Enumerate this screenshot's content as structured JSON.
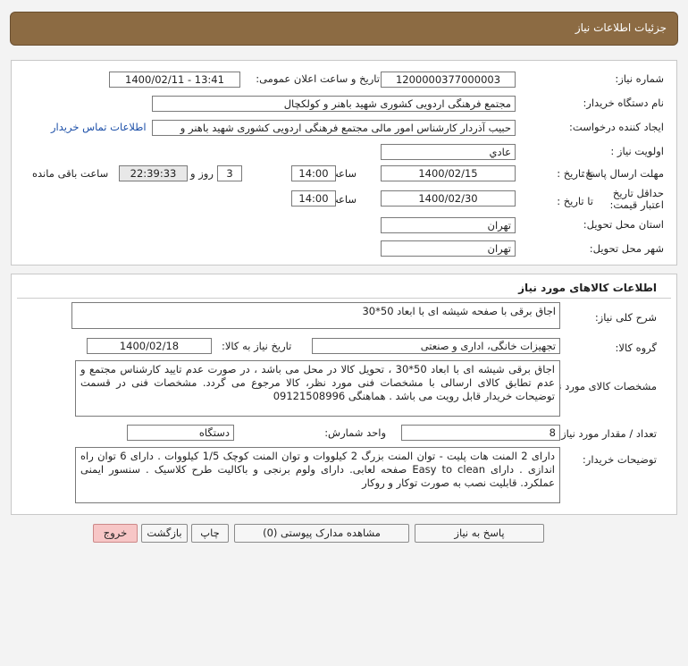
{
  "header": {
    "title": "جزئیات اطلاعات نیاز"
  },
  "details": {
    "need_number_label": "شماره نیاز:",
    "need_number": "1200000377000003",
    "announce_label": "تاریخ و ساعت اعلان عمومی:",
    "announce_value": "1400/02/11 - 13:41",
    "buyer_org_label": "نام دستگاه خریدار:",
    "buyer_org": "مجتمع فرهنگی اردویی کشوری شهید باهنر و کولکچال",
    "requester_label": "ایجاد کننده درخواست:",
    "requester": "حبیب آذردار کارشناس امور مالی  مجتمع فرهنگی اردویی کشوری شهید باهنر و",
    "contact_link": "اطلاعات تماس خریدار",
    "priority_label": "اولویت نیاز :",
    "priority": "عادي",
    "reply_deadline_label": "مهلت ارسال پاسخ:",
    "to_date_label": "تا تاریخ :",
    "reply_date": "1400/02/15",
    "time_label": "ساعت",
    "reply_time": "14:00",
    "days_value": "3",
    "days_label": "روز و",
    "remaining_time": "22:39:33",
    "remaining_label": "ساعت باقی مانده",
    "validity_label": "حداقل تاریخ اعتبار قیمت:",
    "validity_date": "1400/02/30",
    "validity_time": "14:00",
    "province_label": "استان محل تحویل:",
    "province": "تهران",
    "city_label": "شهر محل تحویل:",
    "city": "تهران"
  },
  "goods": {
    "section_title": "اطلاعات کالاهای مورد نیاز",
    "summary_label": "شرح کلی نیاز:",
    "summary": "اجاق برقی با صفحه شیشه ای با ابعاد 50*30",
    "group_label": "گروه کالا:",
    "group": "تجهیزات خانگی، اداری و صنعتی",
    "need_date_label": "تاریخ نیاز به کالا:",
    "need_date": "1400/02/18",
    "specs_label": "مشخصات کالای مورد نیاز:",
    "specs": "اجاق برقی شیشه ای با ابعاد 50*30 ، تحویل کالا در محل می باشد ، در صورت عدم تایید کارشناس مجتمع و عدم تطابق کالای ارسالی با مشخصات فنی مورد نظر، کالا مرجوع می گردد. مشخصات فنی در قسمت توضیحات خریدار قابل رویت می باشد . هماهنگی 09121508996",
    "qty_label": "تعداد / مقدار مورد نیاز:",
    "qty": "8",
    "unit_label": "واحد شمارش:",
    "unit": "دستگاه",
    "buyer_notes_label": "توضیحات خریدار:",
    "buyer_notes": "دارای 2 المنت هات پلیت - توان المنت بزرگ 2 کیلووات و توان المنت کوچک 1/5 کیلووات . دارای 6 توان راه اندازی . دارای Easy to clean صفحه لعابی. دارای ولوم برنجی و باکالیت طرح کلاسیک . سنسور ایمنی عملکرد. قابلیت نصب به صورت توکار و روکار"
  },
  "buttons": {
    "reply": "پاسخ به نیاز",
    "attachments": "مشاهده مدارک پیوستی (0)",
    "print": "چاپ",
    "back": "بازگشت",
    "exit": "خروج"
  }
}
